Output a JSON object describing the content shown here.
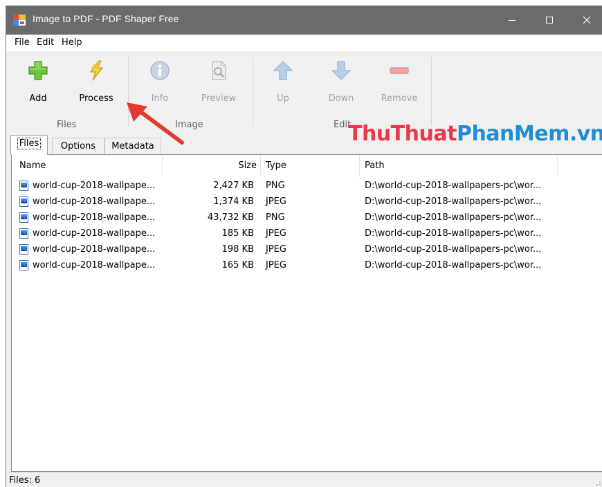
{
  "window": {
    "title": "Image to PDF - PDF Shaper Free",
    "titlebar_color": "#6b6b6b"
  },
  "menu": [
    "File",
    "Edit",
    "Help"
  ],
  "toolbar": {
    "add": "Add",
    "process": "Process",
    "info": "Info",
    "preview": "Preview",
    "up": "Up",
    "down": "Down",
    "remove": "Remove",
    "groups": {
      "files": "Files",
      "image": "Image",
      "edit": "Edit"
    }
  },
  "tabs": [
    "Files",
    "Options",
    "Metadata"
  ],
  "watermark": {
    "part1": "ThuThuat",
    "part2": "PhanMem.vn"
  },
  "columns": {
    "name": "Name",
    "size": "Size",
    "type": "Type",
    "path": "Path"
  },
  "files": [
    {
      "name": "world-cup-2018-wallpape...",
      "size": "2,427 KB",
      "type": "PNG",
      "path": "D:\\world-cup-2018-wallpapers-pc\\wor..."
    },
    {
      "name": "world-cup-2018-wallpape...",
      "size": "1,374 KB",
      "type": "JPEG",
      "path": "D:\\world-cup-2018-wallpapers-pc\\wor..."
    },
    {
      "name": "world-cup-2018-wallpape...",
      "size": "43,732 KB",
      "type": "PNG",
      "path": "D:\\world-cup-2018-wallpapers-pc\\wor..."
    },
    {
      "name": "world-cup-2018-wallpape...",
      "size": "185 KB",
      "type": "JPEG",
      "path": "D:\\world-cup-2018-wallpapers-pc\\wor..."
    },
    {
      "name": "world-cup-2018-wallpape...",
      "size": "198 KB",
      "type": "JPEG",
      "path": "D:\\world-cup-2018-wallpapers-pc\\wor..."
    },
    {
      "name": "world-cup-2018-wallpape...",
      "size": "165 KB",
      "type": "JPEG",
      "path": "D:\\world-cup-2018-wallpapers-pc\\wor..."
    }
  ],
  "status": {
    "text": "Files: 6"
  },
  "icons": {
    "app": "app-icon",
    "add": "plus-icon",
    "process": "lightning-icon",
    "info": "info-icon",
    "preview": "preview-icon",
    "up": "arrow-up-icon",
    "down": "arrow-down-icon",
    "remove": "minus-icon",
    "file": "image-file-icon",
    "annotation": "arrow-annotation"
  },
  "colors": {
    "accent_red": "#e8394b",
    "accent_blue": "#1e8fd6",
    "add_green": "#5bbf2a"
  }
}
